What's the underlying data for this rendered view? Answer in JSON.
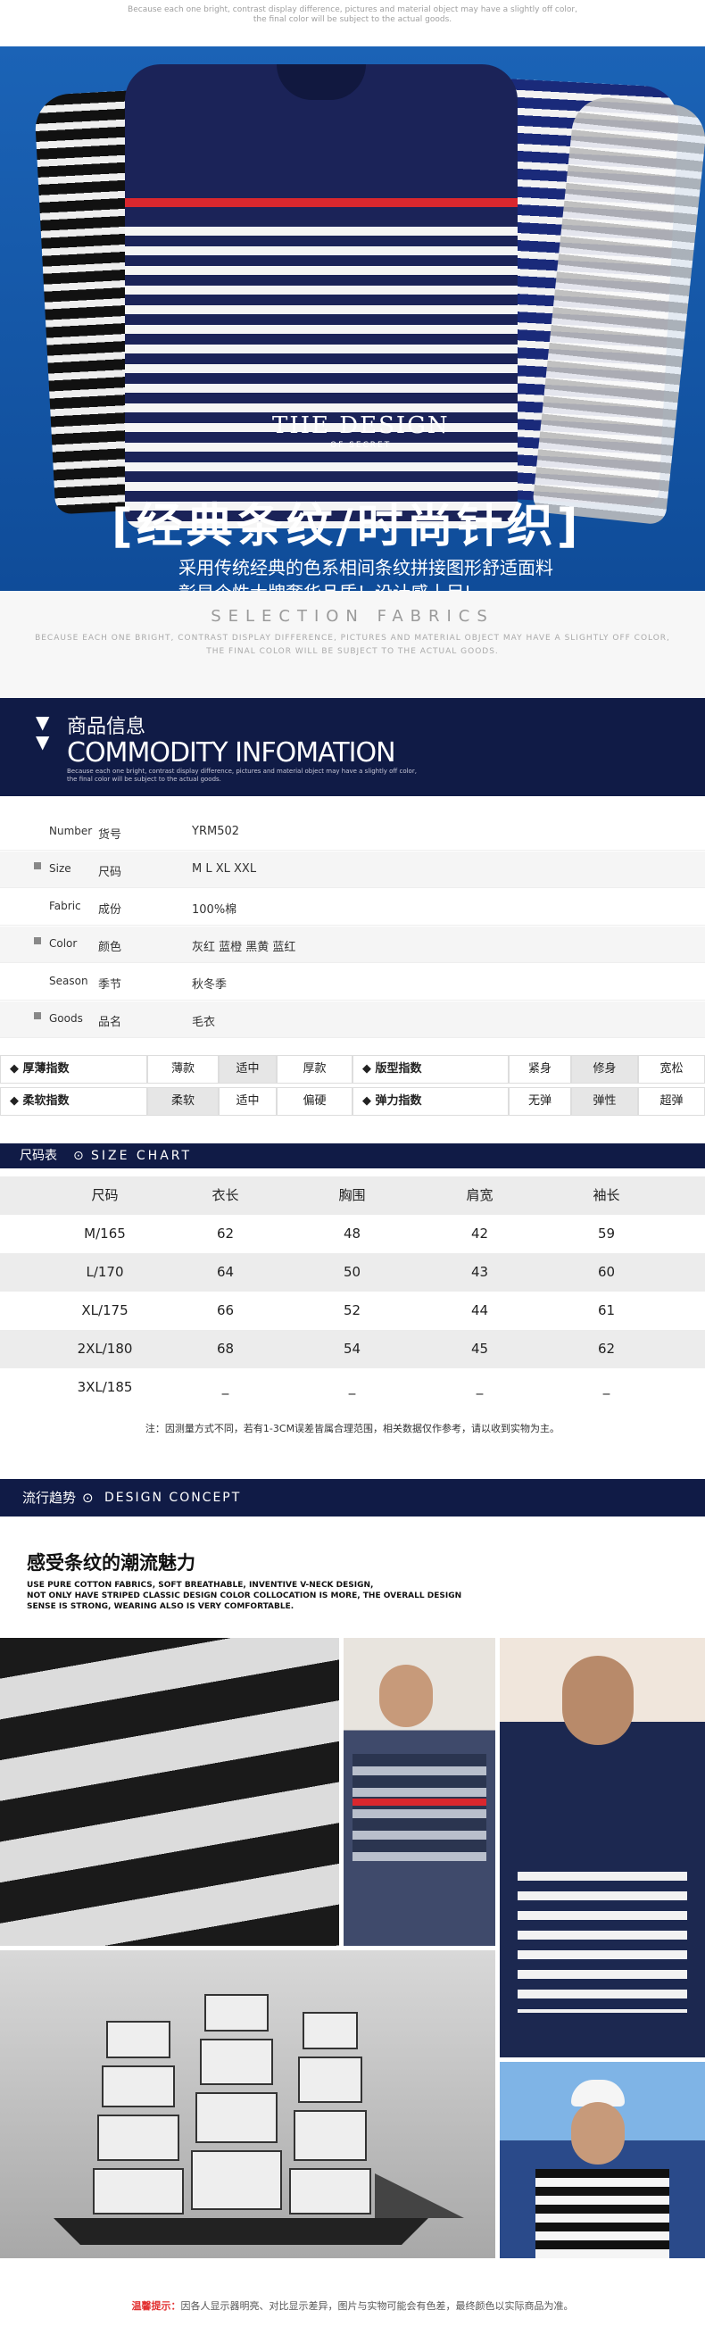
{
  "top_note_line1": "Because each one bright, contrast display difference, pictures and material object may have a slightly off color,",
  "top_note_line2": "the final color will be subject to the actual goods.",
  "hero": {
    "design_text": "THE DESIGN",
    "design_sub": "OF SECRET",
    "title": "[经典条纹/时尚针织]",
    "subtitle1": "采用传统经典的色系相间条纹拼接图形舒适面料",
    "subtitle2": "彰显个性大牌奢华品质！设计感十足!"
  },
  "fabric": {
    "title": "SELECTION FABRICS",
    "line1": "BECAUSE EACH ONE BRIGHT, CONTRAST DISPLAY DIFFERENCE, PICTURES AND MATERIAL OBJECT MAY HAVE A SLIGHTLY OFF COLOR,",
    "line2": "THE FINAL COLOR WILL BE SUBJECT TO THE ACTUAL GOODS."
  },
  "commodity": {
    "cn": "商品信息",
    "en": "COMMODITY INFOMATION",
    "note1": "Because each one bright, contrast display difference, pictures and material object may have a slightly off color,",
    "note2": "the final color will be subject to the actual goods."
  },
  "info_rows": [
    {
      "en": "Number",
      "cn": "货号",
      "value": "YRM502"
    },
    {
      "en": "Size",
      "cn": "尺码",
      "value": "M    L    XL    XXL"
    },
    {
      "en": "Fabric",
      "cn": "成份",
      "value": "100%棉"
    },
    {
      "en": "Color",
      "cn": "颜色",
      "value": "灰红      蓝橙      黑黄      蓝红"
    },
    {
      "en": "Season",
      "cn": "季节",
      "value": "秋冬季"
    },
    {
      "en": "Goods",
      "cn": "品名",
      "value": "毛衣"
    }
  ],
  "indices": {
    "row1": [
      {
        "label": "◆ 厚薄指数"
      },
      {
        "label": "薄款"
      },
      {
        "label": "适中"
      },
      {
        "label": "厚款"
      },
      {
        "label": "◆ 版型指数"
      },
      {
        "label": "紧身"
      },
      {
        "label": "修身"
      },
      {
        "label": "宽松"
      }
    ],
    "row2": [
      {
        "label": "◆ 柔软指数"
      },
      {
        "label": "柔软"
      },
      {
        "label": "适中"
      },
      {
        "label": "偏硬"
      },
      {
        "label": "◆ 弹力指数"
      },
      {
        "label": "无弹"
      },
      {
        "label": "弹性"
      },
      {
        "label": "超弹"
      }
    ]
  },
  "size_chart": {
    "cn": "尺码表",
    "en": "SIZE CHART",
    "headers": [
      "尺码",
      "衣长",
      "胸围",
      "肩宽",
      "袖长"
    ],
    "rows": [
      [
        "M/165",
        "62",
        "48",
        "42",
        "59"
      ],
      [
        "L/170",
        "64",
        "50",
        "43",
        "60"
      ],
      [
        "XL/175",
        "66",
        "52",
        "44",
        "61"
      ],
      [
        "2XL/180",
        "68",
        "54",
        "45",
        "62"
      ],
      [
        "3XL/185",
        "_",
        "_",
        "_",
        "_"
      ]
    ],
    "note": "注：因测量方式不同，若有1-3CM误差皆属合理范围，相关数据仅作参考，请以收到实物为主。"
  },
  "concept": {
    "cn": "流行趋势",
    "en": "DESIGN CONCEPT",
    "headline": "感受条纹的潮流魅力",
    "desc1": "USE PURE COTTON FABRICS, SOFT BREATHABLE, INVENTIVE V-NECK DESIGN,",
    "desc2": "NOT ONLY HAVE STRIPED CLASSIC DESIGN COLOR COLLOCATION IS MORE, THE OVERALL DESIGN",
    "desc3": "SENSE IS STRONG, WEARING ALSO IS VERY COMFORTABLE."
  },
  "bottom": {
    "label": "温馨提示：",
    "text": "因各人显示器明亮、对比显示差异，图片与实物可能会有色差，最终颜色以实际商品为准。"
  },
  "colors": {
    "navy": "#101b46",
    "hero_blue": "#1565b8",
    "row_grey": "#ececec",
    "accent_red": "#d9272e"
  }
}
